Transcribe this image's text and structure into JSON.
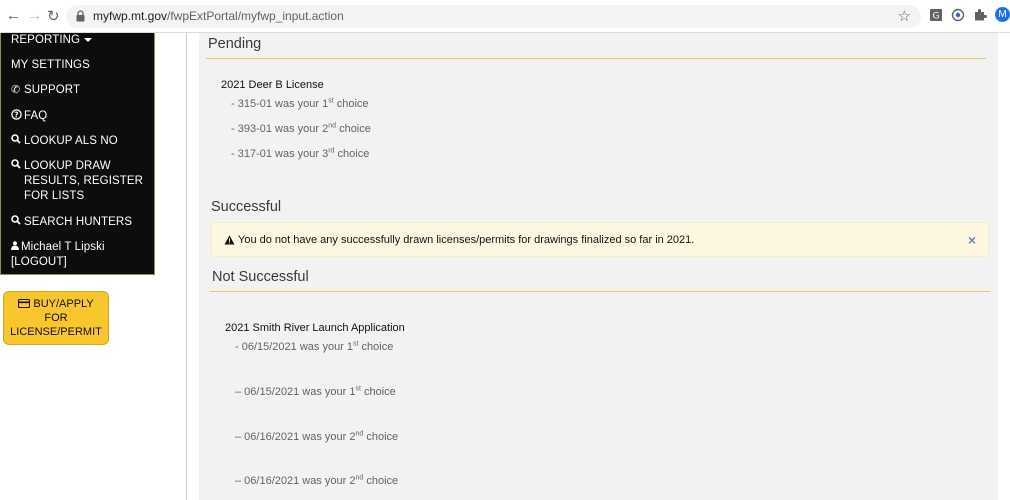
{
  "browser": {
    "url_domain": "myfwp.mt.gov",
    "url_path": "/fwpExtPortal/myfwp_input.action",
    "avatar_letter": "M"
  },
  "sidebar": {
    "reporting": "REPORTING",
    "my_settings": "MY SETTINGS",
    "support": "SUPPORT",
    "faq": "FAQ",
    "lookup_als": "LOOKUP ALS NO",
    "lookup_draw_1": "LOOKUP DRAW",
    "lookup_draw_2": "RESULTS, REGISTER",
    "lookup_draw_3": "FOR LISTS",
    "search_hunters": "SEARCH HUNTERS",
    "user_name": "Michael T Lipski",
    "logout": "[LOGOUT]"
  },
  "buy_button": {
    "line1": "BUY/APPLY",
    "line2": "FOR",
    "line3": "LICENSE/PERMIT"
  },
  "pending": {
    "title": "Pending",
    "license": "2021 Deer B License",
    "choices": [
      {
        "text": "- 315-01 was your 1",
        "ord": "st",
        "tail": " choice"
      },
      {
        "text": "- 393-01 was your 2",
        "ord": "nd",
        "tail": " choice"
      },
      {
        "text": "- 317-01 was your 3",
        "ord": "rd",
        "tail": " choice"
      }
    ]
  },
  "successful": {
    "title": "Successful",
    "alert": "You do not have any successfully drawn licenses/permits for drawings finalized so far in 2021.",
    "close": "×"
  },
  "not_successful": {
    "title": "Not Successful",
    "license": "2021 Smith River Launch Application",
    "choices": [
      {
        "text": "- 06/15/2021 was your 1",
        "ord": "st",
        "tail": " choice"
      },
      {
        "text": "– 06/15/2021 was your 1",
        "ord": "st",
        "tail": " choice"
      },
      {
        "text": "– 06/16/2021 was your 2",
        "ord": "nd",
        "tail": " choice"
      },
      {
        "text": "– 06/16/2021 was your 2",
        "ord": "nd",
        "tail": " choice"
      }
    ]
  },
  "colors": {
    "sidebar_bg": "#0d0d0d",
    "button_yellow": "#f9c62e",
    "rule_gold": "#e8c766",
    "alert_bg": "#fdf7e2"
  }
}
